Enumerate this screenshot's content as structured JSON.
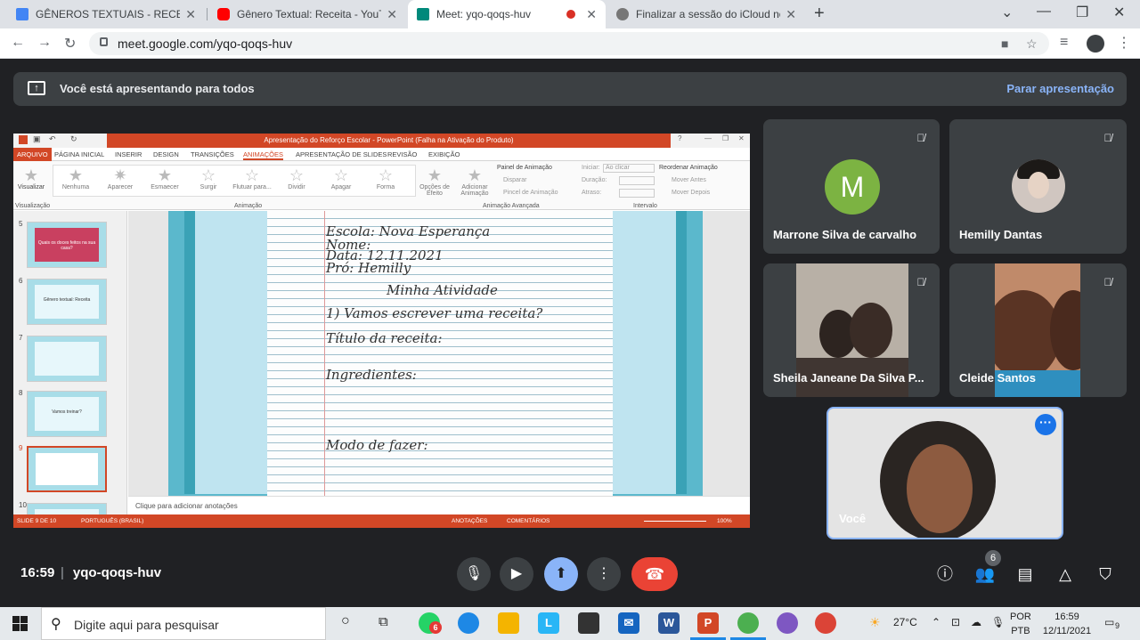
{
  "browser": {
    "tabs": [
      {
        "title": "GÊNEROS TEXTUAIS - RECEITA - (",
        "icon": "docs-grid-icon",
        "color": "#4285f4"
      },
      {
        "title": "Gênero Textual: Receita - YouTub",
        "icon": "youtube-icon",
        "color": "#ff0000"
      },
      {
        "title": "Meet: yqo-qoqs-huv",
        "icon": "meet-icon",
        "color": "#00897b"
      },
      {
        "title": "Finalizar a sessão do iCloud no iP",
        "icon": "apple-icon",
        "color": "#555555"
      }
    ],
    "url": "meet.google.com/yqo-qoqs-huv"
  },
  "banner": {
    "text": "Você está apresentando para todos",
    "stop_label": "Parar apresentação"
  },
  "ppt": {
    "title": "Apresentação do Reforço Escolar - PowerPoint (Falha na Ativação do Produto)",
    "tabs": [
      "ARQUIVO",
      "PÁGINA INICIAL",
      "INSERIR",
      "DESIGN",
      "TRANSIÇÕES",
      "ANIMAÇÕES",
      "APRESENTAÇÃO DE SLIDES",
      "REVISÃO",
      "EXIBIÇÃO"
    ],
    "ribbon": {
      "preview": "Visualizar",
      "animations": [
        "Nenhuma",
        "Aparecer",
        "Esmaecer",
        "Surgir",
        "Flutuar para...",
        "Dividir",
        "Apagar",
        "Forma"
      ],
      "effect_options": "Opções de Efeito",
      "add_animation": "Adicionar Animação",
      "panel": "Painel de Animação",
      "trigger": "Disparar",
      "painter": "Pincel de Animação",
      "start": "Iniciar:",
      "start_value": "Ao clicar",
      "duration": "Duração:",
      "delay": "Atraso:",
      "reorder": "Reordenar Animação",
      "move_before": "Mover Antes",
      "move_after": "Mover Depois",
      "groups": [
        "Visualização",
        "Animação",
        "Animação Avançada",
        "Intervalo"
      ]
    },
    "thumbs": [
      {
        "num": "5",
        "text": "Quais os doces feitos na sua casa?"
      },
      {
        "num": "6",
        "text": "Gênero textual: Receita"
      },
      {
        "num": "7",
        "text": ""
      },
      {
        "num": "8",
        "text": "Vamos treinar?"
      },
      {
        "num": "9",
        "text": ""
      },
      {
        "num": "10",
        "text": ""
      }
    ],
    "slide_lines": [
      "Escola: Nova Esperança",
      "Nome:",
      "Data: 12.11.2021",
      "Pró: Hemilly",
      "Minha Atividade",
      "1) Vamos escrever uma receita?",
      "Título da receita:",
      "Ingredientes:",
      "Modo de fazer:"
    ],
    "notes_placeholder": "Clique para adicionar anotações",
    "status": {
      "slide": "SLIDE 9 DE 10",
      "language": "PORTUGUÊS (BRASIL)",
      "notes": "ANOTAÇÕES",
      "comments": "COMENTÁRIOS",
      "zoom": "100%"
    }
  },
  "participants": [
    {
      "name": "Marrone Silva de carvalho",
      "initial": "M",
      "avatar_color": "#7cb342"
    },
    {
      "name": "Hemilly Dantas"
    },
    {
      "name": "Sheila Janeane Da Silva P..."
    },
    {
      "name": "Cleide Santos"
    }
  ],
  "self": {
    "name": "Você"
  },
  "meeting": {
    "time": "16:59",
    "code": "yqo-qoqs-huv",
    "participant_count": "6"
  },
  "taskbar": {
    "search_placeholder": "Digite aqui para pesquisar",
    "whatsapp_badge": "6",
    "weather": "27°C",
    "lang1": "POR",
    "lang2": "PTB",
    "time": "16:59",
    "date": "12/11/2021",
    "notif_count": "9"
  }
}
